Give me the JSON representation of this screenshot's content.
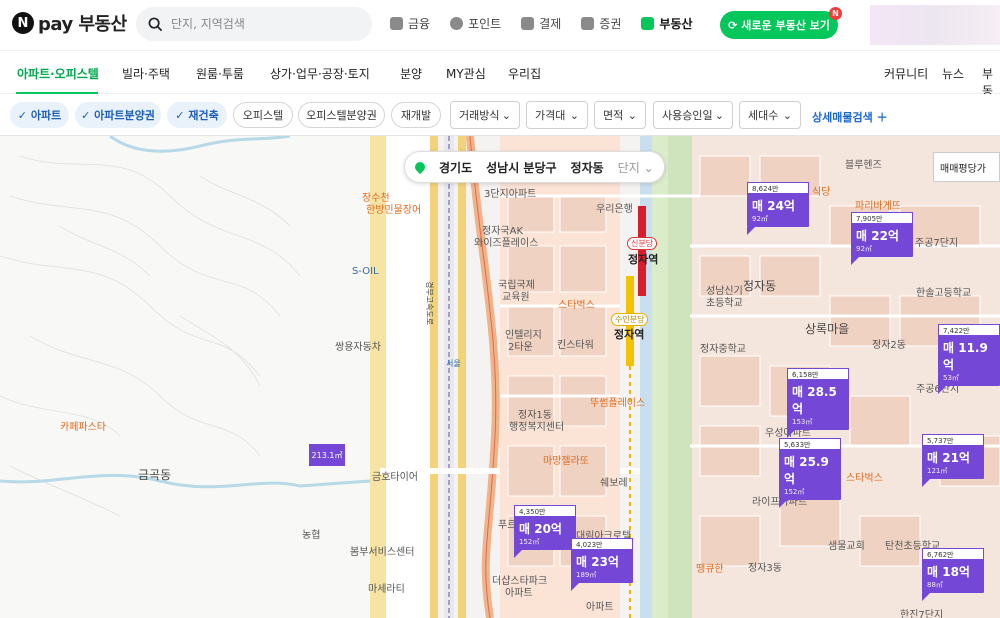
{
  "header": {
    "logo_text": "pay 부동산",
    "search_placeholder": "단지, 지역검색",
    "services": [
      "금융",
      "포인트",
      "결제",
      "증권",
      "부동산"
    ],
    "new_button": "새로운 부동산 보기",
    "new_badge": "N"
  },
  "categories": [
    "아파트·오피스텔",
    "빌라·주택",
    "원룸·투룸",
    "상가·업무·공장·토지",
    "분양",
    "MY관심",
    "우리집"
  ],
  "right_links": [
    "커뮤니티",
    "뉴스",
    "부동"
  ],
  "filters": {
    "chips_on": [
      "아파트",
      "아파트분양권",
      "재건축"
    ],
    "chips_off": [
      "오피스텔",
      "오피스텔분양권",
      "재개발"
    ],
    "dropdowns": [
      "거래방식",
      "가격대",
      "면적",
      "사용승인일",
      "세대수"
    ],
    "advanced": "상세매물검색"
  },
  "location": {
    "province": "경기도",
    "district": "성남시 분당구",
    "dong": "정자동",
    "complex": "단지"
  },
  "map_select": "매매평당가",
  "markers": [
    {
      "top": "8,624만",
      "price": "매 24억",
      "area": "92㎡"
    },
    {
      "top": "7,905만",
      "price": "매 22억",
      "area": "92㎡"
    },
    {
      "top": "7,422만",
      "price": "매 11.9억",
      "area": "53㎡"
    },
    {
      "top": "6,158만",
      "price": "매 28.5억",
      "area": "153㎡"
    },
    {
      "top": "5,633만",
      "price": "매 25.9억",
      "area": "152㎡"
    },
    {
      "top": "5,737만",
      "price": "매 21억",
      "area": "121㎡"
    },
    {
      "top": "4,350만",
      "price": "매 20억",
      "area": "152㎡"
    },
    {
      "top": "4,023만",
      "price": "매 23억",
      "area": "189㎡"
    },
    {
      "top": "6,762만",
      "price": "매 18억",
      "area": "88㎡"
    }
  ],
  "mini_marker": "213.1㎡",
  "map_labels": {
    "jangsu": "장수천",
    "hanbang": "한방민물장어",
    "soil": "S-OIL",
    "ssangyong": "쌍용자동차",
    "cafe": "카페파스타",
    "geumgok": "금곡동",
    "kumho": "금호타이어",
    "nonghyup": "농협",
    "bombus": "봄부서비스센터",
    "masserati": "마세라티",
    "danji3": "3단지아파트",
    "jeongja_ak": "정자국AK",
    "wise": "와이즈플레이스",
    "woori": "우리은행",
    "gukrip": "국립국제",
    "gukrip2": "교육원",
    "starbucks": "스타벅스",
    "intel": "인텔리지",
    "town2": "2타운",
    "kinsta": "킨스타워",
    "tous": "뚜썸플레이스",
    "jeongja1": "정자1동",
    "admin": "행정복지센터",
    "maman": "마망젤라또",
    "shell": "쉐보레",
    "hotel": "더샵스타파크",
    "apt": "아파트",
    "daerim": "대림아크로텔",
    "jeongjadong": "정자동",
    "sangrok": "상록마을",
    "seongnam": "성남신기",
    "school": "초등학교",
    "jeongjaMid": "정자중학교",
    "hansol": "한솔고등학교",
    "jugong7": "주공7단지",
    "jeongja2": "정자2동",
    "jugong6": "주공6단지",
    "woosung": "우성아파트",
    "life": "라이프아파트",
    "saemmul": "샘물교회",
    "tancheon": "탄천초등학교",
    "jeongja3": "정자3동",
    "hanjin": "한진7단지",
    "blue": "블루헨즈",
    "paris": "파리바게뜨",
    "sikdang": "식당",
    "starbucks2": "스타벅스",
    "ttanggyu": "땡큐한",
    "jeongja_st": "정자역",
    "jeongja_st2": "정자역",
    "sinbundang": "신분당",
    "suin": "수인분당",
    "hwangbo": "서울",
    "gyeongbu": "경부고속도로",
    "puru": "푸르",
    "aparteu": "아파트"
  }
}
